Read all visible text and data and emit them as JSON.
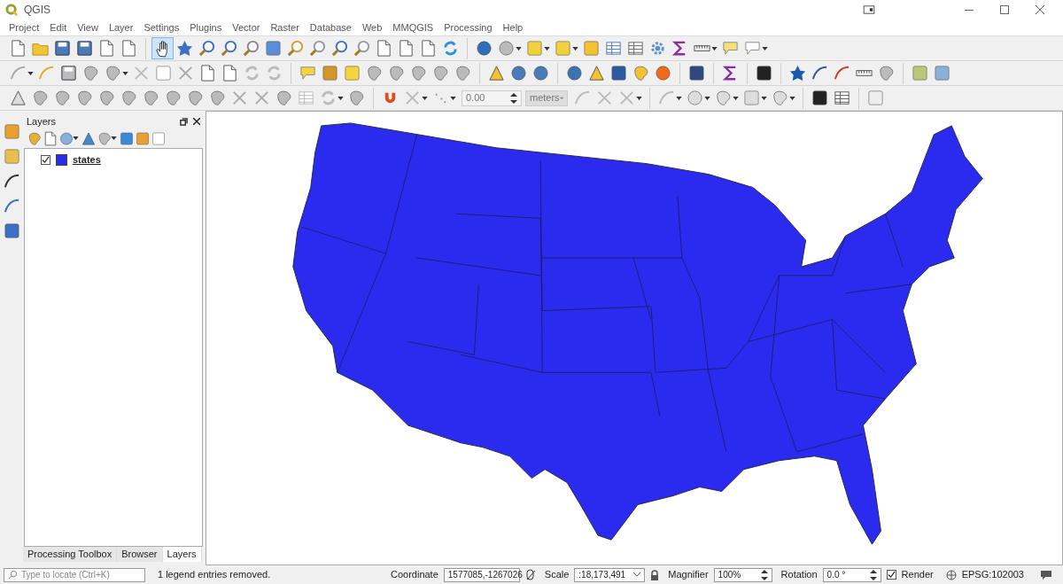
{
  "window": {
    "title": "QGIS"
  },
  "menu": [
    "Project",
    "Edit",
    "View",
    "Layer",
    "Settings",
    "Plugins",
    "Vector",
    "Raster",
    "Database",
    "Web",
    "MMQGIS",
    "Processing",
    "Help"
  ],
  "snapping": {
    "tolerance": "0.00",
    "units": "meters"
  },
  "layers_panel": {
    "title": "Layers",
    "layers": [
      {
        "name": "states",
        "checked": true,
        "color": "#2b2bef"
      }
    ]
  },
  "panel_tabs": [
    {
      "label": "Processing Toolbox",
      "selected": false
    },
    {
      "label": "Browser",
      "selected": false
    },
    {
      "label": "Layers",
      "selected": true
    }
  ],
  "status_bar": {
    "locate_placeholder": "Type to locate (Ctrl+K)",
    "message": "1 legend entries removed.",
    "coordinate_label": "Coordinate",
    "coordinate": "1577085,-1267026",
    "scale_label": "Scale",
    "scale": ":18,173,491",
    "magnifier_label": "Magnifier",
    "magnifier": "100%",
    "rotation_label": "Rotation",
    "rotation": "0.0 °",
    "render_label": "Render",
    "render_checked": true,
    "crs": "EPSG:102003"
  }
}
